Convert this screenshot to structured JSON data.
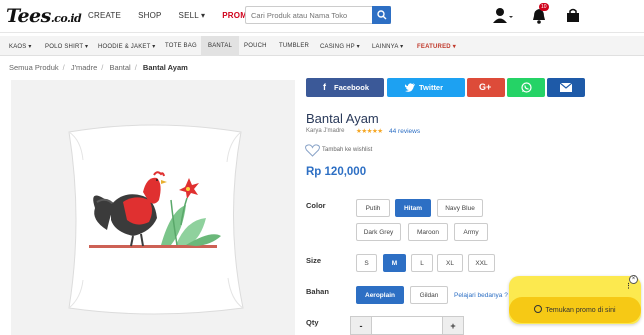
{
  "logo": {
    "main": "Tees",
    "suffix": ".co.id"
  },
  "nav": {
    "create": "CREATE",
    "shop": "SHOP",
    "sell": "SELL",
    "promo": "PROMO"
  },
  "search": {
    "placeholder": "Cari Produk atau Nama Toko"
  },
  "notifications": {
    "count": "10"
  },
  "categories": [
    "KAOS",
    "POLO SHIRT",
    "HOODIE & JAKET",
    "TOTE BAG",
    "BANTAL",
    "POUCH",
    "TUMBLER",
    "CASING HP",
    "LAINNYA",
    "FEATURED"
  ],
  "breadcrumb": {
    "home": "Semua Produk",
    "store": "J'madre",
    "category": "Bantal",
    "current": "Bantal Ayam"
  },
  "share": {
    "facebook": "Facebook",
    "twitter": "Twitter",
    "google": "G+"
  },
  "product": {
    "title": "Bantal Ayam",
    "karya": "Karya J'madre",
    "stars": "★★★★★",
    "reviews": "44 reviews",
    "wishlist": "Tambah ke wishlist",
    "price": "Rp 120,000"
  },
  "color": {
    "label": "Color",
    "options": [
      "Putih",
      "Hitam",
      "Navy Blue",
      "Dark Grey",
      "Maroon",
      "Army"
    ],
    "selected": "Hitam"
  },
  "size": {
    "label": "Size",
    "options": [
      "S",
      "M",
      "L",
      "XL",
      "XXL"
    ],
    "selected": "M"
  },
  "bahan": {
    "label": "Bahan",
    "options": [
      "Aeroplain",
      "Gildan"
    ],
    "selected": "Aeroplain",
    "link": "Pelajari bedanya ?"
  },
  "qty": {
    "label": "Qty",
    "minus": "-",
    "plus": "+"
  },
  "promo_widget": {
    "button": "Temukan promo di sini",
    "close": "×",
    "dots": "⋮"
  },
  "colors": {
    "accent": "#2d6fc4",
    "promo": "#d0021b",
    "facebook": "#3b5998",
    "twitter": "#1da1f2",
    "google": "#dd4b39",
    "whatsapp": "#25d366",
    "email": "#1e5aa8"
  }
}
